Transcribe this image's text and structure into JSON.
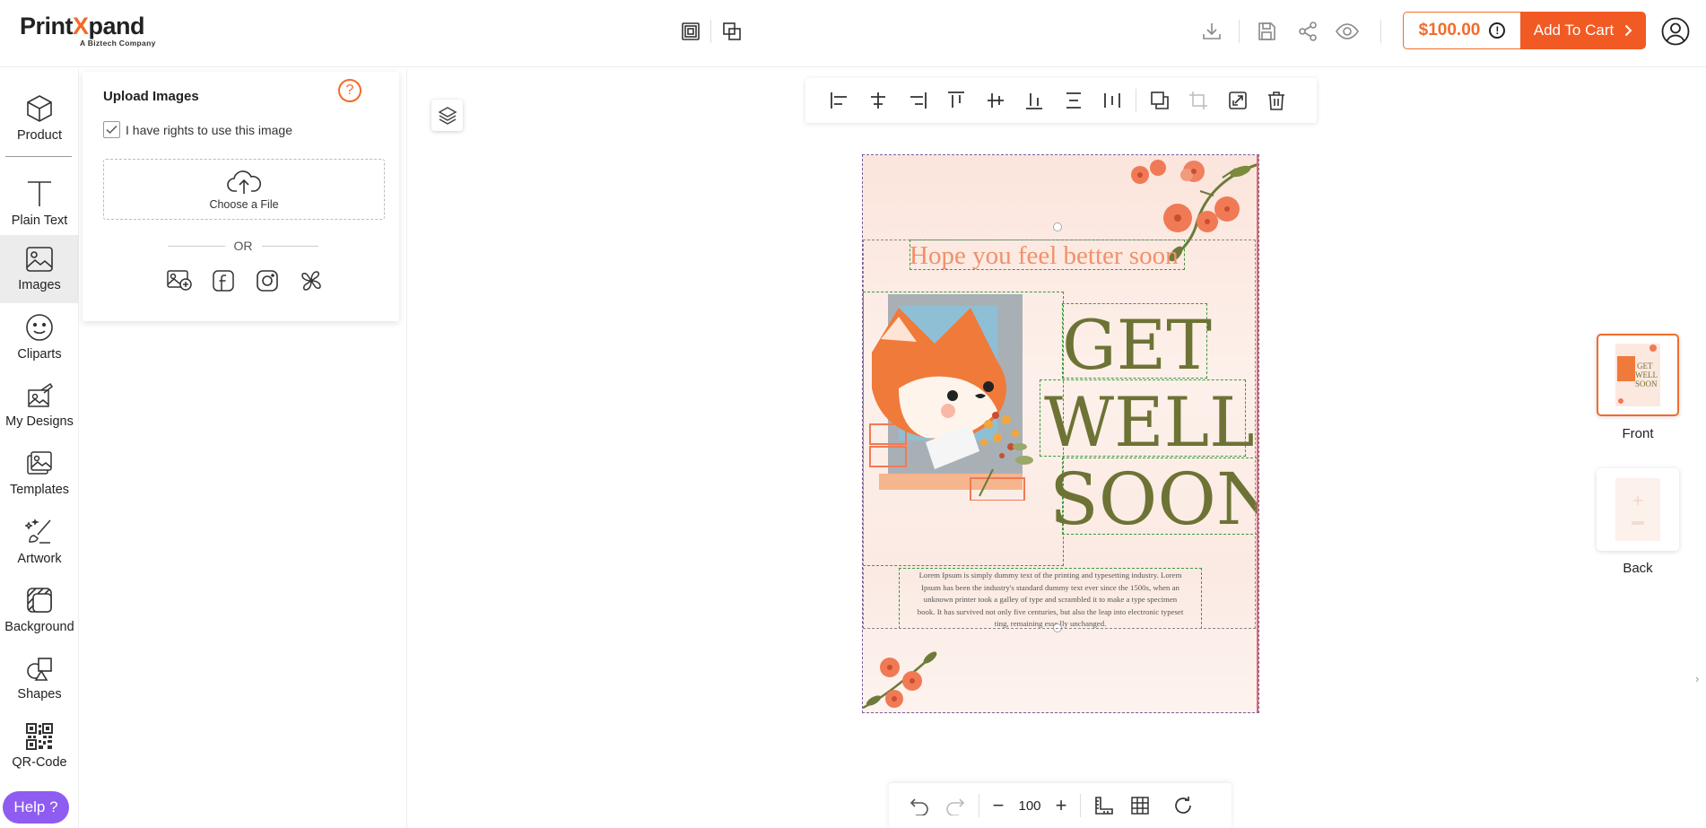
{
  "header": {
    "logo_brand_1": "Print",
    "logo_brand_x": "X",
    "logo_brand_2": "pand",
    "logo_tag": "A Biztech Company",
    "price": "$100.00",
    "price_info": "!",
    "cart_label": "Add To Cart",
    "accent_color": "#f25a24"
  },
  "leftnav": {
    "items": [
      {
        "label": "Product",
        "icon": "cube-icon"
      },
      {
        "label": "Plain Text",
        "icon": "text-icon"
      },
      {
        "label": "Images",
        "icon": "image-icon"
      },
      {
        "label": "Cliparts",
        "icon": "smiley-icon"
      },
      {
        "label": "My Designs",
        "icon": "designs-icon"
      },
      {
        "label": "Templates",
        "icon": "templates-icon"
      },
      {
        "label": "Artwork",
        "icon": "brush-icon"
      },
      {
        "label": "Background",
        "icon": "background-icon"
      },
      {
        "label": "Shapes",
        "icon": "shapes-icon"
      },
      {
        "label": "QR-Code",
        "icon": "qr-code-icon"
      }
    ],
    "active": "Images",
    "help_label": "Help ?"
  },
  "panel": {
    "title": "Upload Images",
    "help_symbol": "?",
    "rights_label": "I have rights to use this image",
    "rights_checked": true,
    "choose_file": "Choose a File",
    "or_label": "OR"
  },
  "canvas": {
    "headline": "Hope you feel better soon",
    "get": "GET",
    "well": "WELL",
    "soon": "SOON",
    "body_lines": [
      "Lorem Ipsum is simply dummy text of the printing and typesetting industry. Lorem",
      "Ipsum has been the industry's standard dummy text ever since the 1500s, when an",
      "unknown printer took a galley of type and scrambled it to make a type specimen",
      "book. It has survived not only five centuries, but also the leap into electronic typeset",
      "ting, remaining esse    lly unchanged."
    ]
  },
  "side": {
    "front_label": "Front",
    "back_label": "Back"
  },
  "bottombar": {
    "zoom": "100",
    "minus": "−",
    "plus": "+"
  }
}
